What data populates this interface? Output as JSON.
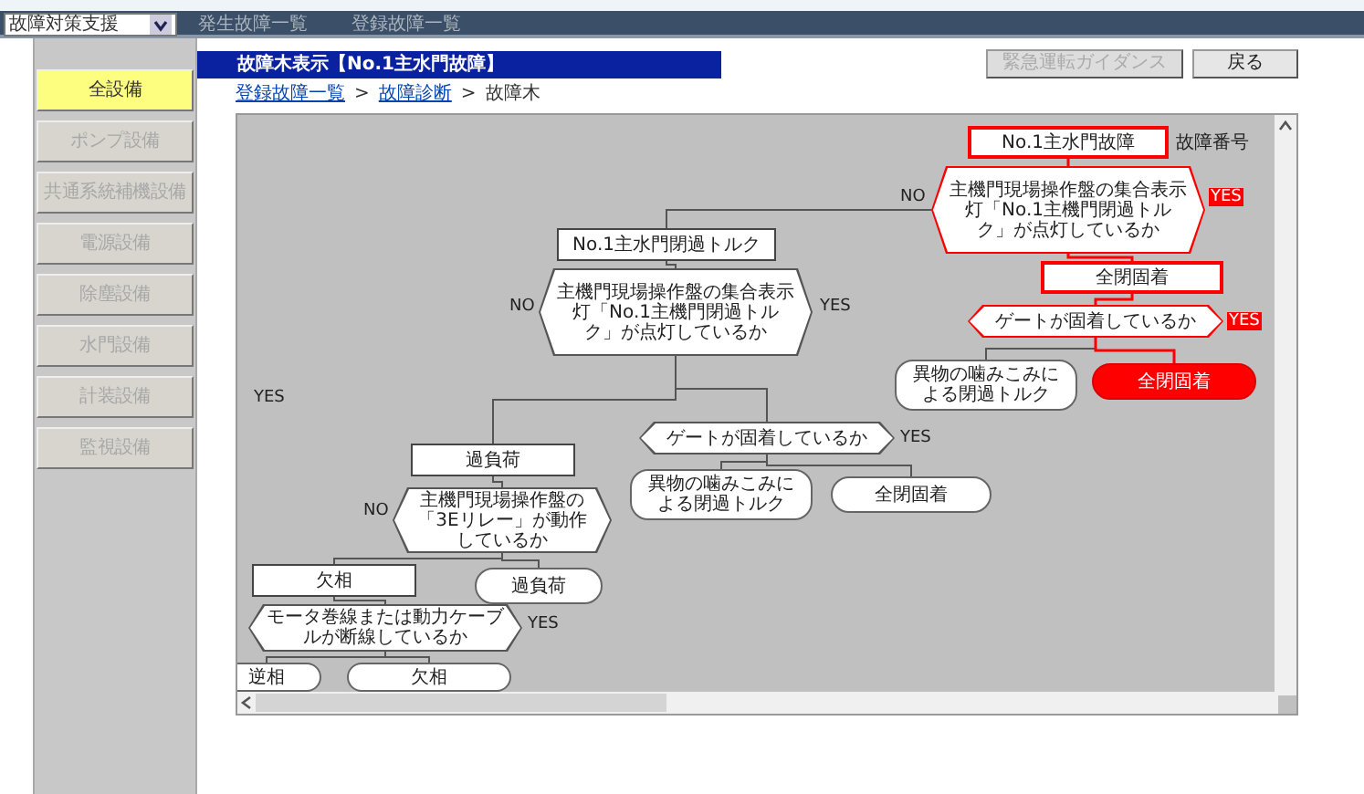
{
  "app_menu": {
    "value": "故障対策支援"
  },
  "top_tabs": [
    {
      "label": "発生故障一覧",
      "selected": false
    },
    {
      "label": "登録故障一覧",
      "selected": false
    }
  ],
  "sidebar": [
    {
      "label": "全設備",
      "selected": true,
      "disabled": false
    },
    {
      "label": "ポンプ設備",
      "selected": false,
      "disabled": true
    },
    {
      "label": "共通系統補機設備",
      "selected": false,
      "disabled": true
    },
    {
      "label": "電源設備",
      "selected": false,
      "disabled": true
    },
    {
      "label": "除塵設備",
      "selected": false,
      "disabled": true
    },
    {
      "label": "水門設備",
      "selected": false,
      "disabled": true
    },
    {
      "label": "計装設備",
      "selected": false,
      "disabled": true
    },
    {
      "label": "監視設備",
      "selected": false,
      "disabled": true
    }
  ],
  "header": {
    "title": "故障木表示【No.1主水門故障】"
  },
  "buttons": [
    {
      "label": "緊急運転ガイダンス",
      "disabled": true
    },
    {
      "label": "戻る",
      "disabled": false
    }
  ],
  "breadcrumb": [
    {
      "label": "登録故障一覧",
      "link": true
    },
    {
      "separator": ">",
      "label": "故障診断",
      "link": true
    },
    {
      "separator": ">",
      "label": "故障木",
      "link": false
    }
  ],
  "fault_tree": {
    "nodes": [
      {
        "kind": "event",
        "text": "No.1主水門故障",
        "highlighted": true
      },
      {
        "kind": "question",
        "text": "主機門現場操作盤の集合表示灯「No.1主機門閉過トルク」が点灯しているか",
        "highlighted": true
      },
      {
        "kind": "event",
        "text": "全閉固着",
        "highlighted": true
      },
      {
        "kind": "question",
        "text": "ゲートが固着しているか",
        "highlighted": true
      },
      {
        "kind": "cause",
        "text": "異物の噛みこみによる閉過トルク",
        "highlighted": false
      },
      {
        "kind": "cause",
        "text": "全閉固着",
        "highlighted": true
      },
      {
        "kind": "event",
        "text": "No.1主水門閉過トルク",
        "highlighted": false
      },
      {
        "kind": "question",
        "text": "主機門現場操作盤の集合表示灯「No.1主機門閉過トルク」が点灯しているか",
        "highlighted": false
      },
      {
        "kind": "question",
        "text": "ゲートが固着しているか",
        "highlighted": false
      },
      {
        "kind": "cause",
        "text": "異物の噛みこみによる閉過トルク",
        "highlighted": false
      },
      {
        "kind": "cause",
        "text": "全閉固着",
        "highlighted": false
      },
      {
        "kind": "event",
        "text": "過負荷",
        "highlighted": false
      },
      {
        "kind": "question",
        "text": "主機門現場操作盤の「3Eリレー」が動作しているか",
        "highlighted": false
      },
      {
        "kind": "event",
        "text": "欠相",
        "highlighted": false
      },
      {
        "kind": "cause",
        "text": "過負荷",
        "highlighted": false
      },
      {
        "kind": "question",
        "text": "モータ巻線または動力ケーブルが断線しているか",
        "highlighted": false
      },
      {
        "kind": "cause",
        "text": "逆相",
        "highlighted": false
      },
      {
        "kind": "cause",
        "text": "欠相",
        "highlighted": false
      }
    ],
    "labels": [
      {
        "text": "NO",
        "highlighted": false
      },
      {
        "text": "YES",
        "highlighted": true
      },
      {
        "text": "YES",
        "highlighted": true
      },
      {
        "text": "NO",
        "highlighted": false
      },
      {
        "text": "YES",
        "highlighted": false
      },
      {
        "text": "YES",
        "highlighted": false
      },
      {
        "text": "YES",
        "highlighted": false
      },
      {
        "text": "NO",
        "highlighted": false
      },
      {
        "text": "YES",
        "highlighted": false
      }
    ],
    "notes": [
      {
        "text": "故障番号"
      }
    ]
  }
}
